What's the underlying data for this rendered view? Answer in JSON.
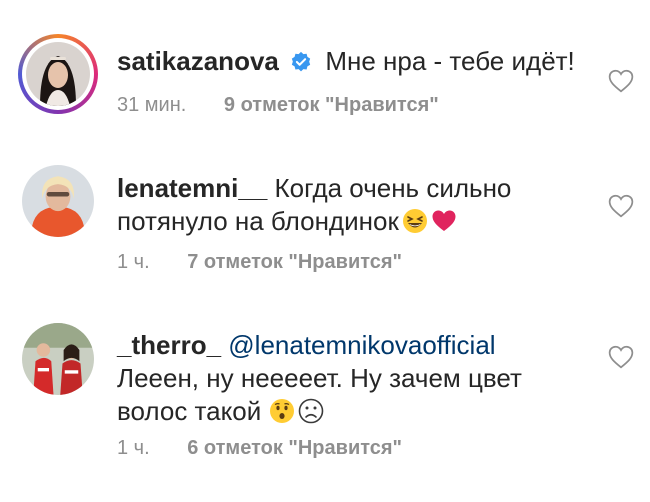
{
  "comments": [
    {
      "username": "satikazanova",
      "verified": true,
      "text": "Мне нра - тебе идёт!",
      "time": "31 мин.",
      "likes": "9 отметок \"Нравится\"",
      "story_ring": true
    },
    {
      "username": "lenatemni__",
      "verified": false,
      "text": "Когда очень сильно потянуло на блондинок",
      "emojis": [
        "grinning-squinting-face-emoji",
        "red-heart-emoji"
      ],
      "time": "1 ч.",
      "likes": "7 отметок \"Нравится\""
    },
    {
      "username": "_therro_",
      "verified": false,
      "mention": "@lenatemnikovaofficial",
      "text": "Лееен, ну нееееет. Ну зачем цвет волос такой",
      "emojis": [
        "hushed-face-emoji",
        "frowning-face-emoji"
      ],
      "time": "1 ч.",
      "likes": "6 отметок \"Нравится\""
    }
  ],
  "colors": {
    "text": "#262626",
    "meta": "#8e8e8e",
    "mention": "#00376b",
    "verified": "#3897f0",
    "heart_emoji": "#e0245e"
  }
}
